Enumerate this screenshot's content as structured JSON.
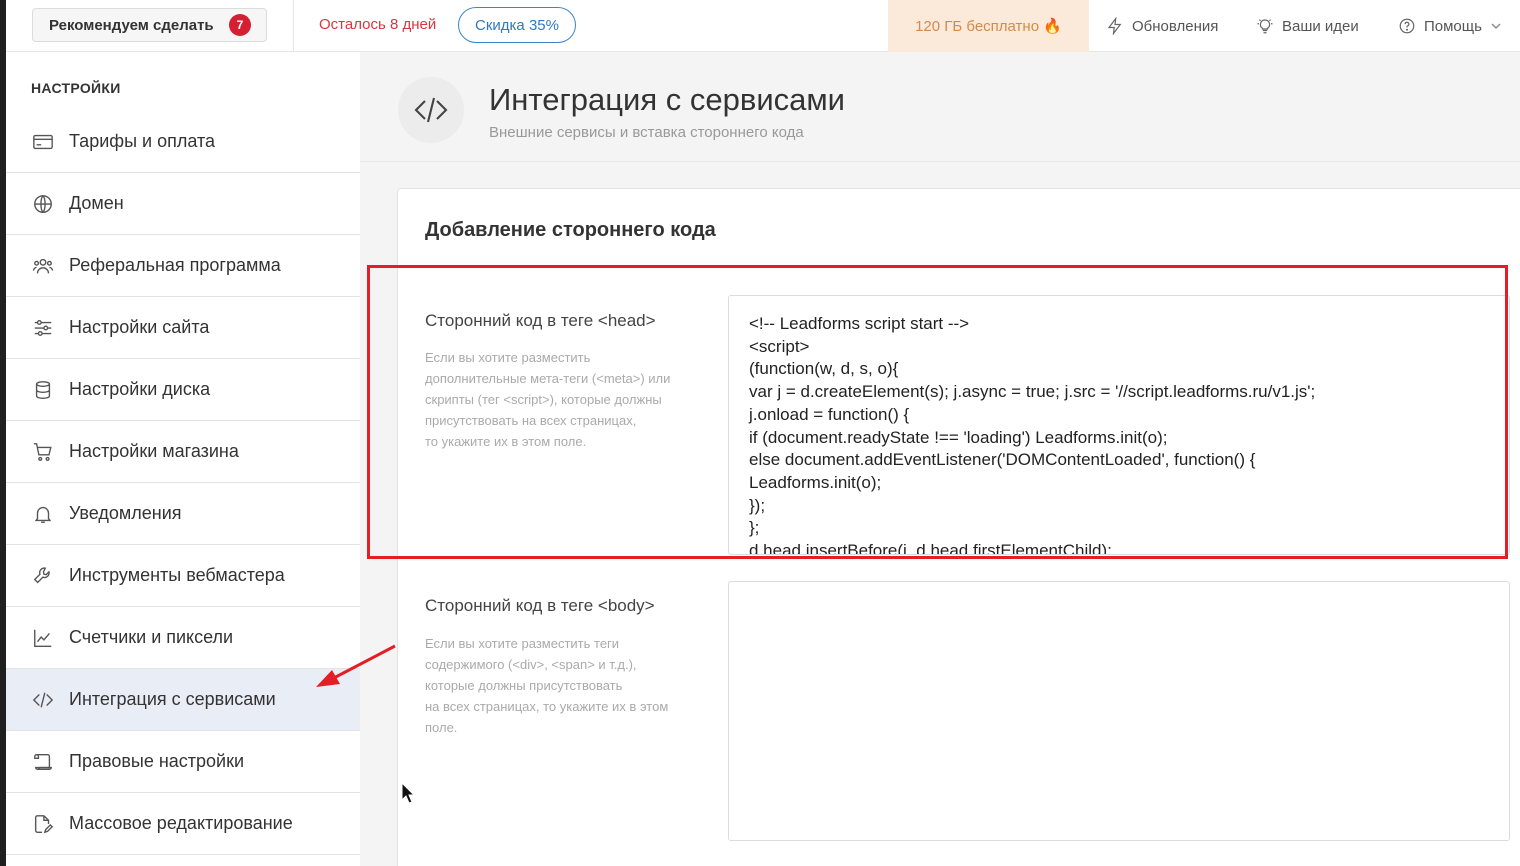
{
  "topbar": {
    "recommend_label": "Рекомендуем сделать",
    "recommend_count": "7",
    "days_left": "Осталось 8 дней",
    "discount": "Скидка 35%",
    "free_storage": "120 ГБ бесплатно 🔥",
    "updates": "Обновления",
    "ideas": "Ваши идеи",
    "help": "Помощь"
  },
  "sidebar": {
    "title": "НАСТРОЙКИ",
    "items": [
      {
        "label": "Тарифы и оплата",
        "icon": "credit-card-icon"
      },
      {
        "label": "Домен",
        "icon": "globe-icon"
      },
      {
        "label": "Реферальная программа",
        "icon": "users-icon"
      },
      {
        "label": "Настройки сайта",
        "icon": "sliders-icon"
      },
      {
        "label": "Настройки диска",
        "icon": "database-icon"
      },
      {
        "label": "Настройки магазина",
        "icon": "cart-icon"
      },
      {
        "label": "Уведомления",
        "icon": "bell-icon"
      },
      {
        "label": "Инструменты вебмастера",
        "icon": "wrench-icon"
      },
      {
        "label": "Счетчики и пиксели",
        "icon": "chart-line-icon"
      },
      {
        "label": "Интеграция с сервисами",
        "icon": "code-icon",
        "active": true
      },
      {
        "label": "Правовые настройки",
        "icon": "scroll-icon"
      },
      {
        "label": "Массовое редактирование",
        "icon": "edit-file-icon"
      }
    ]
  },
  "header": {
    "title": "Интеграция с сервисами",
    "subtitle": "Внешние сервисы и вставка стороннего кода"
  },
  "card": {
    "title": "Добавление стороннего кода",
    "head_field": {
      "label": "Сторонний код в теге <head>",
      "help": [
        "Если вы хотите разместить",
        "дополнительные мета-теги (<meta>) или",
        "скрипты (тег <script>), которые должны",
        "присутствовать на всех страницах,",
        "то укажите их в этом поле."
      ],
      "code": [
        "<!-- Leadforms script start -->",
        "<script>",
        "(function(w, d, s, o){",
        "var j = d.createElement(s); j.async = true; j.src = '//script.leadforms.ru/v1.js';",
        "j.onload = function() {",
        "if (document.readyState !== 'loading') Leadforms.init(o);",
        "else document.addEventListener('DOMContentLoaded', function() {",
        "Leadforms.init(o);",
        "});",
        "};",
        "d.head.insertBefore(j, d.head.firstElementChild);"
      ]
    },
    "body_field": {
      "label": "Сторонний код в теге <body>",
      "help": [
        "Если вы хотите разместить теги",
        "содержимого (<div>, <span> и т.д.),",
        "которые должны присутствовать",
        "на всех страницах, то укажите их в этом",
        "поле."
      ],
      "code": ""
    }
  },
  "colors": {
    "highlight": "#e31e24",
    "active_item_bg": "#e9edf6",
    "discount_border": "#3c84c7",
    "badge": "#d52034"
  }
}
